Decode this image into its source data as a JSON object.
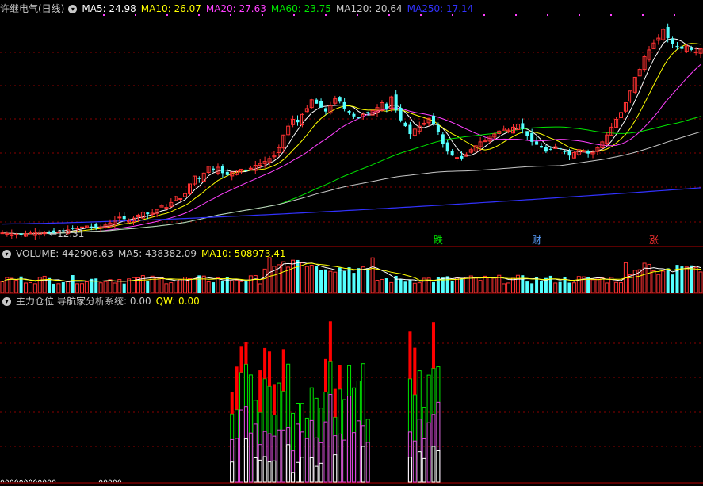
{
  "header_price": {
    "stock_name": "许继电气(日线)",
    "ma5": "MA5: 24.98",
    "ma10": "MA10: 26.07",
    "ma20": "MA20: 27.63",
    "ma60": "MA60: 23.75",
    "ma120": "MA120: 20.64",
    "ma250": "MA250: 17.14"
  },
  "header_volume": {
    "volume": "VOLUME: 442906.63",
    "ma5": "MA5: 438382.09",
    "ma10": "MA10: 508973.41"
  },
  "header_indicator": {
    "name": "主力仓位",
    "formula": "导航家分析系统: 0.00",
    "qw": "QW: 0.00"
  },
  "colors": {
    "up": "#ff3232",
    "down": "#54ffff",
    "ma5": "#ffffff",
    "ma10": "#ffff00",
    "ma20": "#ff40ff",
    "ma60": "#00e600",
    "ma120": "#c8c8c8",
    "ma250": "#3232ff",
    "grid": "#8c0000",
    "ind_red": "#ff0000",
    "ind_green": "#00e600",
    "ind_magenta": "#e040e0",
    "ind_white": "#ffffff"
  },
  "chart_data": [
    {
      "type": "candlestick",
      "price_min_label": "12.31",
      "markers": [
        {
          "index": 93,
          "text": "跌",
          "color": "#00e600"
        },
        {
          "index": 114,
          "text": "财",
          "color": "#5aa0ff"
        },
        {
          "index": 139,
          "text": "涨",
          "color": "#ff3232"
        }
      ],
      "closes": [
        12.5,
        12.45,
        12.4,
        12.35,
        12.31,
        12.4,
        12.5,
        12.55,
        12.6,
        12.5,
        12.45,
        12.5,
        12.6,
        12.7,
        12.8,
        12.9,
        13.0,
        13.1,
        13.2,
        13.1,
        13.0,
        13.1,
        13.3,
        13.5,
        13.8,
        14.1,
        13.9,
        13.8,
        14.0,
        14.3,
        14.6,
        14.4,
        14.5,
        14.9,
        15.3,
        15.1,
        15.6,
        16.2,
        16.0,
        16.5,
        17.5,
        18.3,
        18.0,
        18.6,
        19.3,
        18.9,
        19.2,
        18.6,
        18.4,
        18.7,
        18.9,
        19.0,
        18.8,
        19.1,
        19.4,
        19.6,
        19.8,
        20.1,
        20.4,
        21.2,
        22.5,
        23.4,
        24.1,
        23.8,
        24.6,
        25.2,
        26.1,
        25.7,
        25.3,
        24.9,
        25.5,
        26.2,
        25.9,
        25.2,
        24.8,
        24.4,
        24.2,
        24.6,
        24.7,
        25.0,
        25.3,
        25.8,
        25.2,
        26.4,
        25.0,
        24.0,
        23.4,
        22.6,
        23.1,
        23.4,
        23.7,
        24.2,
        23.6,
        22.8,
        21.6,
        20.8,
        20.4,
        20.2,
        20.1,
        20.5,
        21.0,
        21.4,
        21.8,
        21.9,
        22.4,
        22.6,
        22.9,
        23.2,
        23.0,
        23.3,
        23.6,
        23.1,
        22.4,
        21.8,
        21.5,
        21.2,
        20.8,
        21.0,
        21.3,
        21.1,
        20.8,
        20.4,
        20.7,
        21.0,
        20.9,
        20.6,
        20.7,
        21.2,
        21.8,
        22.5,
        23.3,
        24.1,
        24.8,
        25.8,
        27.0,
        28.4,
        29.2,
        30.5,
        31.2,
        31.9,
        32.4,
        33.3,
        32.4,
        31.8,
        31.5,
        31.3,
        31.6,
        31.2,
        31.0,
        31.3
      ],
      "ma_series": [
        "MA5",
        "MA10",
        "MA20",
        "MA60",
        "MA120",
        "MA250"
      ]
    },
    {
      "type": "bar",
      "title": "VOLUME",
      "series": [
        {
          "name": "VOLUME"
        },
        {
          "name": "MA5"
        },
        {
          "name": "MA10"
        }
      ]
    },
    {
      "type": "bar",
      "title": "主力仓位",
      "series": [
        {
          "name": "导航家分析系统"
        },
        {
          "name": "QW"
        }
      ],
      "active_ranges": [
        [
          49,
          78
        ],
        [
          87,
          93
        ],
        [
          150,
          175
        ]
      ]
    }
  ]
}
